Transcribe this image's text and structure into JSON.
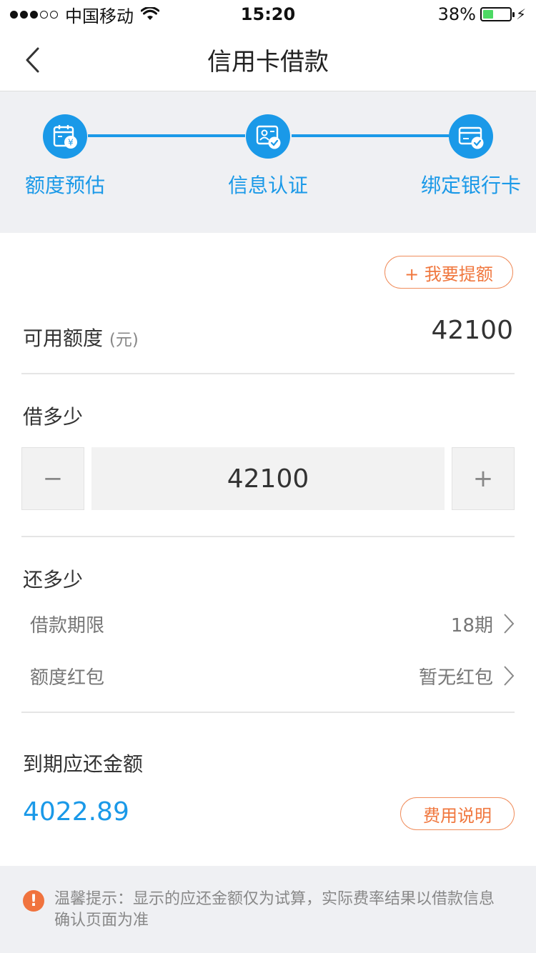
{
  "status_bar": {
    "carrier": "中国移动",
    "time": "15:20",
    "battery": "38%",
    "battery_level": 0.38
  },
  "nav": {
    "title": "信用卡借款",
    "back_icon": "chevron-left-icon"
  },
  "steps": [
    {
      "label": "额度预估",
      "icon": "calendar-yen-icon"
    },
    {
      "label": "信息认证",
      "icon": "id-card-check-icon"
    },
    {
      "label": "绑定银行卡",
      "icon": "bank-card-check-icon"
    }
  ],
  "colors": {
    "primary": "#1a99e8",
    "accent": "#f0773e",
    "background": "#eff0f3"
  },
  "credit": {
    "raise_button": "+ 我要提额",
    "available_label": "可用额度",
    "unit": "(元)",
    "available_value": "42100"
  },
  "borrow": {
    "label": "借多少",
    "minus": "−",
    "plus": "+",
    "value": "42100"
  },
  "repay": {
    "label": "还多少",
    "term_label": "借款期限",
    "term_value": "18期",
    "redpacket_label": "额度红包",
    "redpacket_value": "暂无红包"
  },
  "due": {
    "label": "到期应还金额",
    "amount": "4022.89",
    "fee_button": "费用说明"
  },
  "tip": {
    "icon": "exclamation-icon",
    "text": "温馨提示：显示的应还金额仅为试算，实际费率结果以借款信息确认页面为准"
  }
}
